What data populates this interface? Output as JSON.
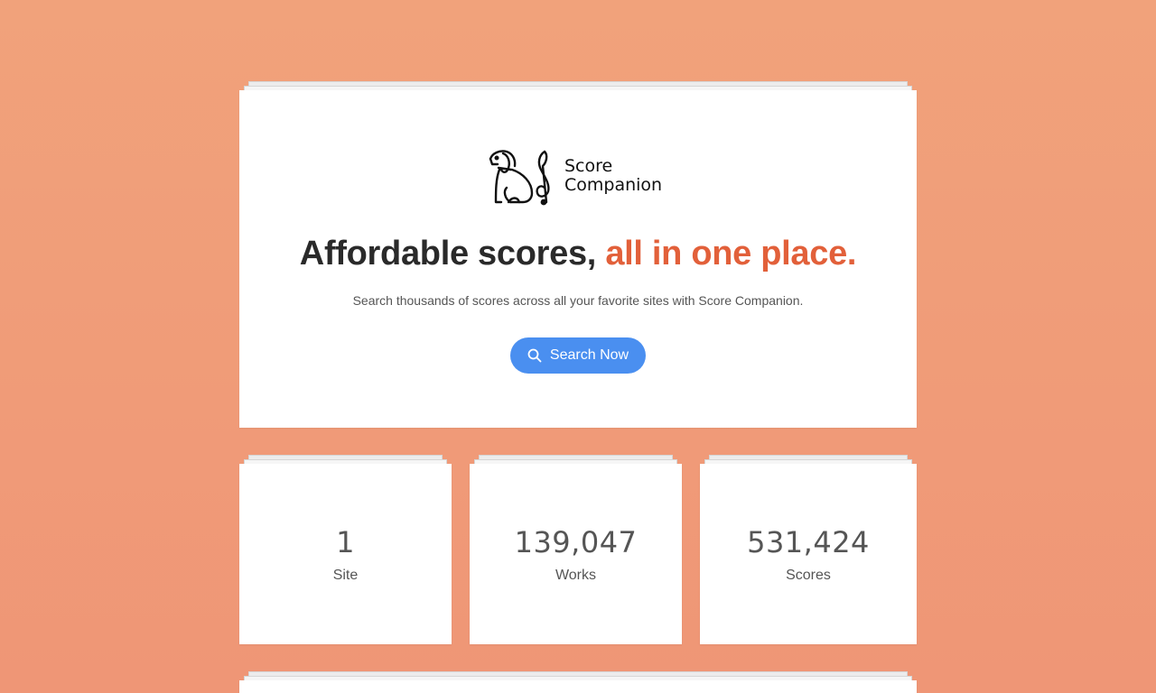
{
  "brand": {
    "name_line1": "Score",
    "name_line2": "Companion",
    "logo_icon": "dog-treble-clef-icon"
  },
  "hero": {
    "headline_main": "Affordable scores, ",
    "headline_accent": "all in one place.",
    "subtitle": "Search thousands of scores across all your favorite sites with Score Companion.",
    "cta_label": "Search Now",
    "cta_icon": "search-icon"
  },
  "stats": [
    {
      "value": "1",
      "label": "Site"
    },
    {
      "value": "139,047",
      "label": "Works"
    },
    {
      "value": "531,424",
      "label": "Scores"
    }
  ],
  "colors": {
    "background": "#f1a27b",
    "accent": "#e2603a",
    "button": "#4a8ff0"
  }
}
